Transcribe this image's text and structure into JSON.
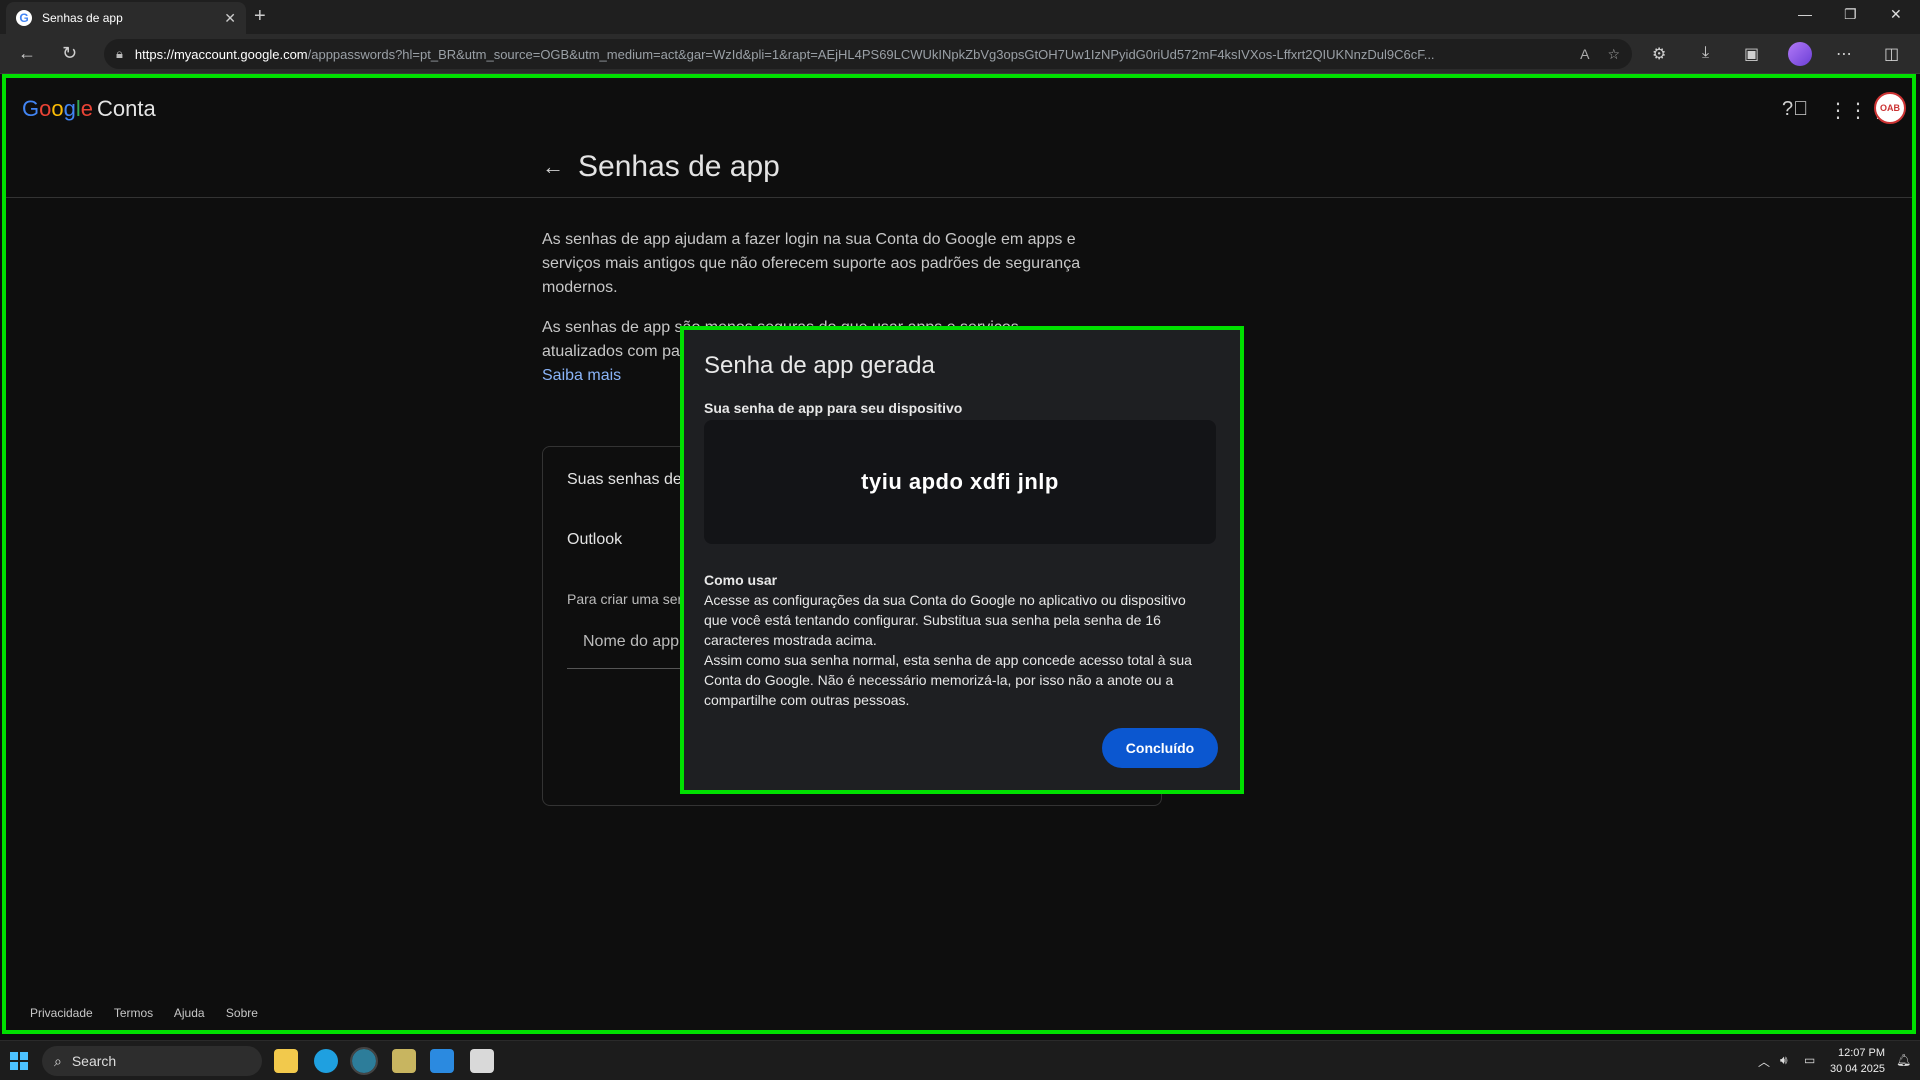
{
  "browser": {
    "tab_title": "Senhas de app",
    "tab_favicon": "G",
    "url_host": "https://myaccount.google.com",
    "url_path": "/apppasswords?hl=pt_BR&utm_source=OGB&utm_medium=act&gar=WzId&pli=1&rapt=AEjHL4PS69LCWUkINpkZbVg3opsGtOH7Uw1IzNPyidG0riUd572mF4ksIVXos-Lffxrt2QIUKNnzDul9C6cF..."
  },
  "header": {
    "logo_letters": [
      "G",
      "o",
      "o",
      "g",
      "l",
      "e"
    ],
    "logo_suffix": "Conta",
    "avatar_text": "OAB"
  },
  "page": {
    "title": "Senhas de app",
    "intro": "As senhas de app ajudam a fazer login na sua Conta do Google em apps e serviços mais antigos que não oferecem suporte aos padrões de segurança modernos.",
    "warning_partial": "As senhas de app são menos seguras do que usar apps e serviços atualizados com pa... senha, verifique se ...",
    "learn_more": "Saiba mais"
  },
  "card": {
    "title": "Suas senhas de",
    "app_name": "Outlook",
    "hint": "Para criar uma ser",
    "input_placeholder": "Nome do app"
  },
  "dialog": {
    "title": "Senha de app gerada",
    "subtitle": "Sua senha de app para seu dispositivo",
    "password": "tyiu apdo xdfi jnlp",
    "howto_heading": "Como usar",
    "howto_p1": "Acesse as configurações da sua Conta do Google no aplicativo ou dispositivo que você está tentando configurar. Substitua sua senha pela senha de 16 caracteres mostrada acima.",
    "howto_p2": "Assim como sua senha normal, esta senha de app concede acesso total à sua Conta do Google. Não é necessário memorizá-la, por isso não a anote ou a compartilhe com outras pessoas.",
    "done_button": "Concluído"
  },
  "footer": {
    "links": [
      "Privacidade",
      "Termos",
      "Ajuda",
      "Sobre"
    ]
  },
  "taskbar": {
    "search_label": "Search",
    "time": "12:07 PM",
    "date": "30 04 2025"
  }
}
